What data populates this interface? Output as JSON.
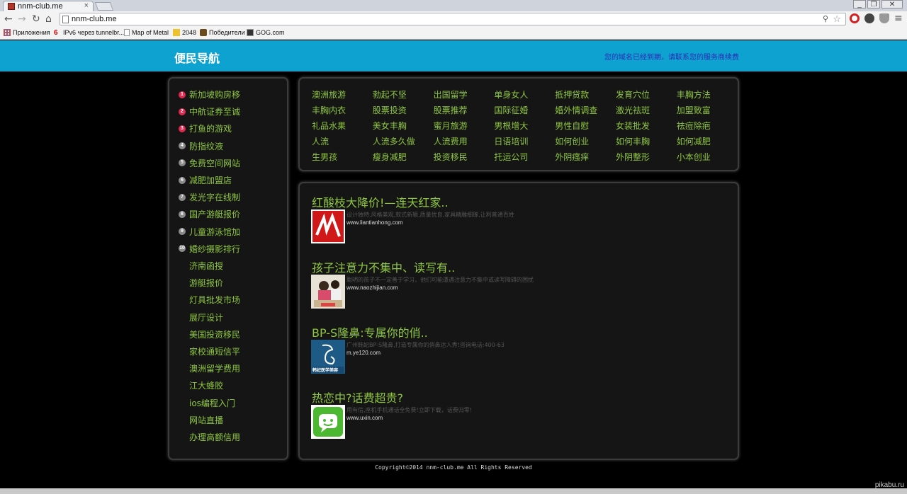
{
  "browser": {
    "tab_title": "nnm-club.me",
    "address": "nnm-club.me",
    "window_controls": [
      "_",
      "❐",
      "✕"
    ],
    "nav_icons": [
      "back-arrow-icon",
      "forward-arrow-icon",
      "reload-icon",
      "home-icon"
    ],
    "bookmarks": [
      {
        "label": "Приложения",
        "icon": "apps-grid-icon"
      },
      {
        "label": "IPv6 через tunnelbr...",
        "icon": "ipv6-icon"
      },
      {
        "label": "Map of Metal",
        "icon": "page-icon"
      },
      {
        "label": "2048",
        "icon": "2048-icon"
      },
      {
        "label": "Победители",
        "icon": "trophy-icon"
      },
      {
        "label": "GOG.com",
        "icon": "gog-icon"
      }
    ]
  },
  "header": {
    "title": "便民导航",
    "notice": "您的域名已经到期，请联系您的服务商续费"
  },
  "sidebar": {
    "items": [
      {
        "num": "1",
        "label": "新加坡购房移"
      },
      {
        "num": "2",
        "label": "中航证券至诚"
      },
      {
        "num": "3",
        "label": "打鱼的游戏"
      },
      {
        "num": "4",
        "label": "防指纹液"
      },
      {
        "num": "5",
        "label": "免费空间网站"
      },
      {
        "num": "6",
        "label": "减肥加盟店"
      },
      {
        "num": "7",
        "label": "发光字在线制"
      },
      {
        "num": "8",
        "label": "国产游艇报价"
      },
      {
        "num": "9",
        "label": "儿童游泳馆加"
      },
      {
        "num": "10",
        "label": "婚纱摄影排行"
      },
      {
        "num": "",
        "label": "济南函授"
      },
      {
        "num": "",
        "label": "游艇报价"
      },
      {
        "num": "",
        "label": "灯具批发市场"
      },
      {
        "num": "",
        "label": "展厅设计"
      },
      {
        "num": "",
        "label": "美国投资移民"
      },
      {
        "num": "",
        "label": "家校通短信平"
      },
      {
        "num": "",
        "label": "澳洲留学费用"
      },
      {
        "num": "",
        "label": "江大蜂胶"
      },
      {
        "num": "",
        "label": "ios编程入门"
      },
      {
        "num": "",
        "label": "网站直播"
      },
      {
        "num": "",
        "label": "办理高额信用"
      }
    ]
  },
  "links": [
    [
      "澳洲旅游",
      "勃起不坚",
      "出国留学",
      "单身女人",
      "抵押贷款",
      "发育穴位",
      "丰胸方法"
    ],
    [
      "丰胸内衣",
      "股票投资",
      "股票推荐",
      "国际征婚",
      "婚外情调查",
      "激光祛斑",
      "加盟致富"
    ],
    [
      "礼品水果",
      "美女丰胸",
      "蜜月旅游",
      "男根增大",
      "男性自慰",
      "女装批发",
      "祛痘除疤"
    ],
    [
      "人流",
      "人流多久做",
      "人流费用",
      "日语培训",
      "如何创业",
      "如何丰胸",
      "如何减肥"
    ],
    [
      "生男孩",
      "瘦身减肥",
      "投资移民",
      "托运公司",
      "外阴瘙痒",
      "外阴整形",
      "小本创业"
    ]
  ],
  "ads": [
    {
      "title": "红酸枝大降价!—连天红家..",
      "desc": "设计独特,风格美观,款式新颖,质量优良,家具精雕细琢,让利普通百姓",
      "url": "www.liantianhong.com",
      "image": "red-calligraphy-logo"
    },
    {
      "title": "孩子注意力不集中、读写有..",
      "desc": "聪明的孩子不一定善于学习，他们可能遭遇注意力不集中或读写障碍的困扰",
      "url": "www.naozhijian.com",
      "image": "child-study-photo"
    },
    {
      "title": "BP-S隆鼻:专属你的俏..",
      "desc": "广州韩妃BP-S隆鼻,打造专属你的俏鼻达人秀!咨询电话:400-63",
      "url": "m.ye120.com",
      "image": "hanfei-logo",
      "image_text": "韩妃医学美容"
    },
    {
      "title": "热恋中?话费超贵?",
      "desc": "用有信,座机手机通话全免费!立即下载，话费归零!",
      "url": "www.uxin.com",
      "image": "uxin-chat-icon"
    }
  ],
  "footer": {
    "copyright": "Copyright©2014 nnm-club.me All Rights Reserved"
  },
  "watermark": "pikabu.ru",
  "colors": {
    "header_bg": "#0ea2d0",
    "link_green": "#8ec640",
    "badge_red": "#e0284f",
    "badge_gray": "#8a8a8a"
  }
}
